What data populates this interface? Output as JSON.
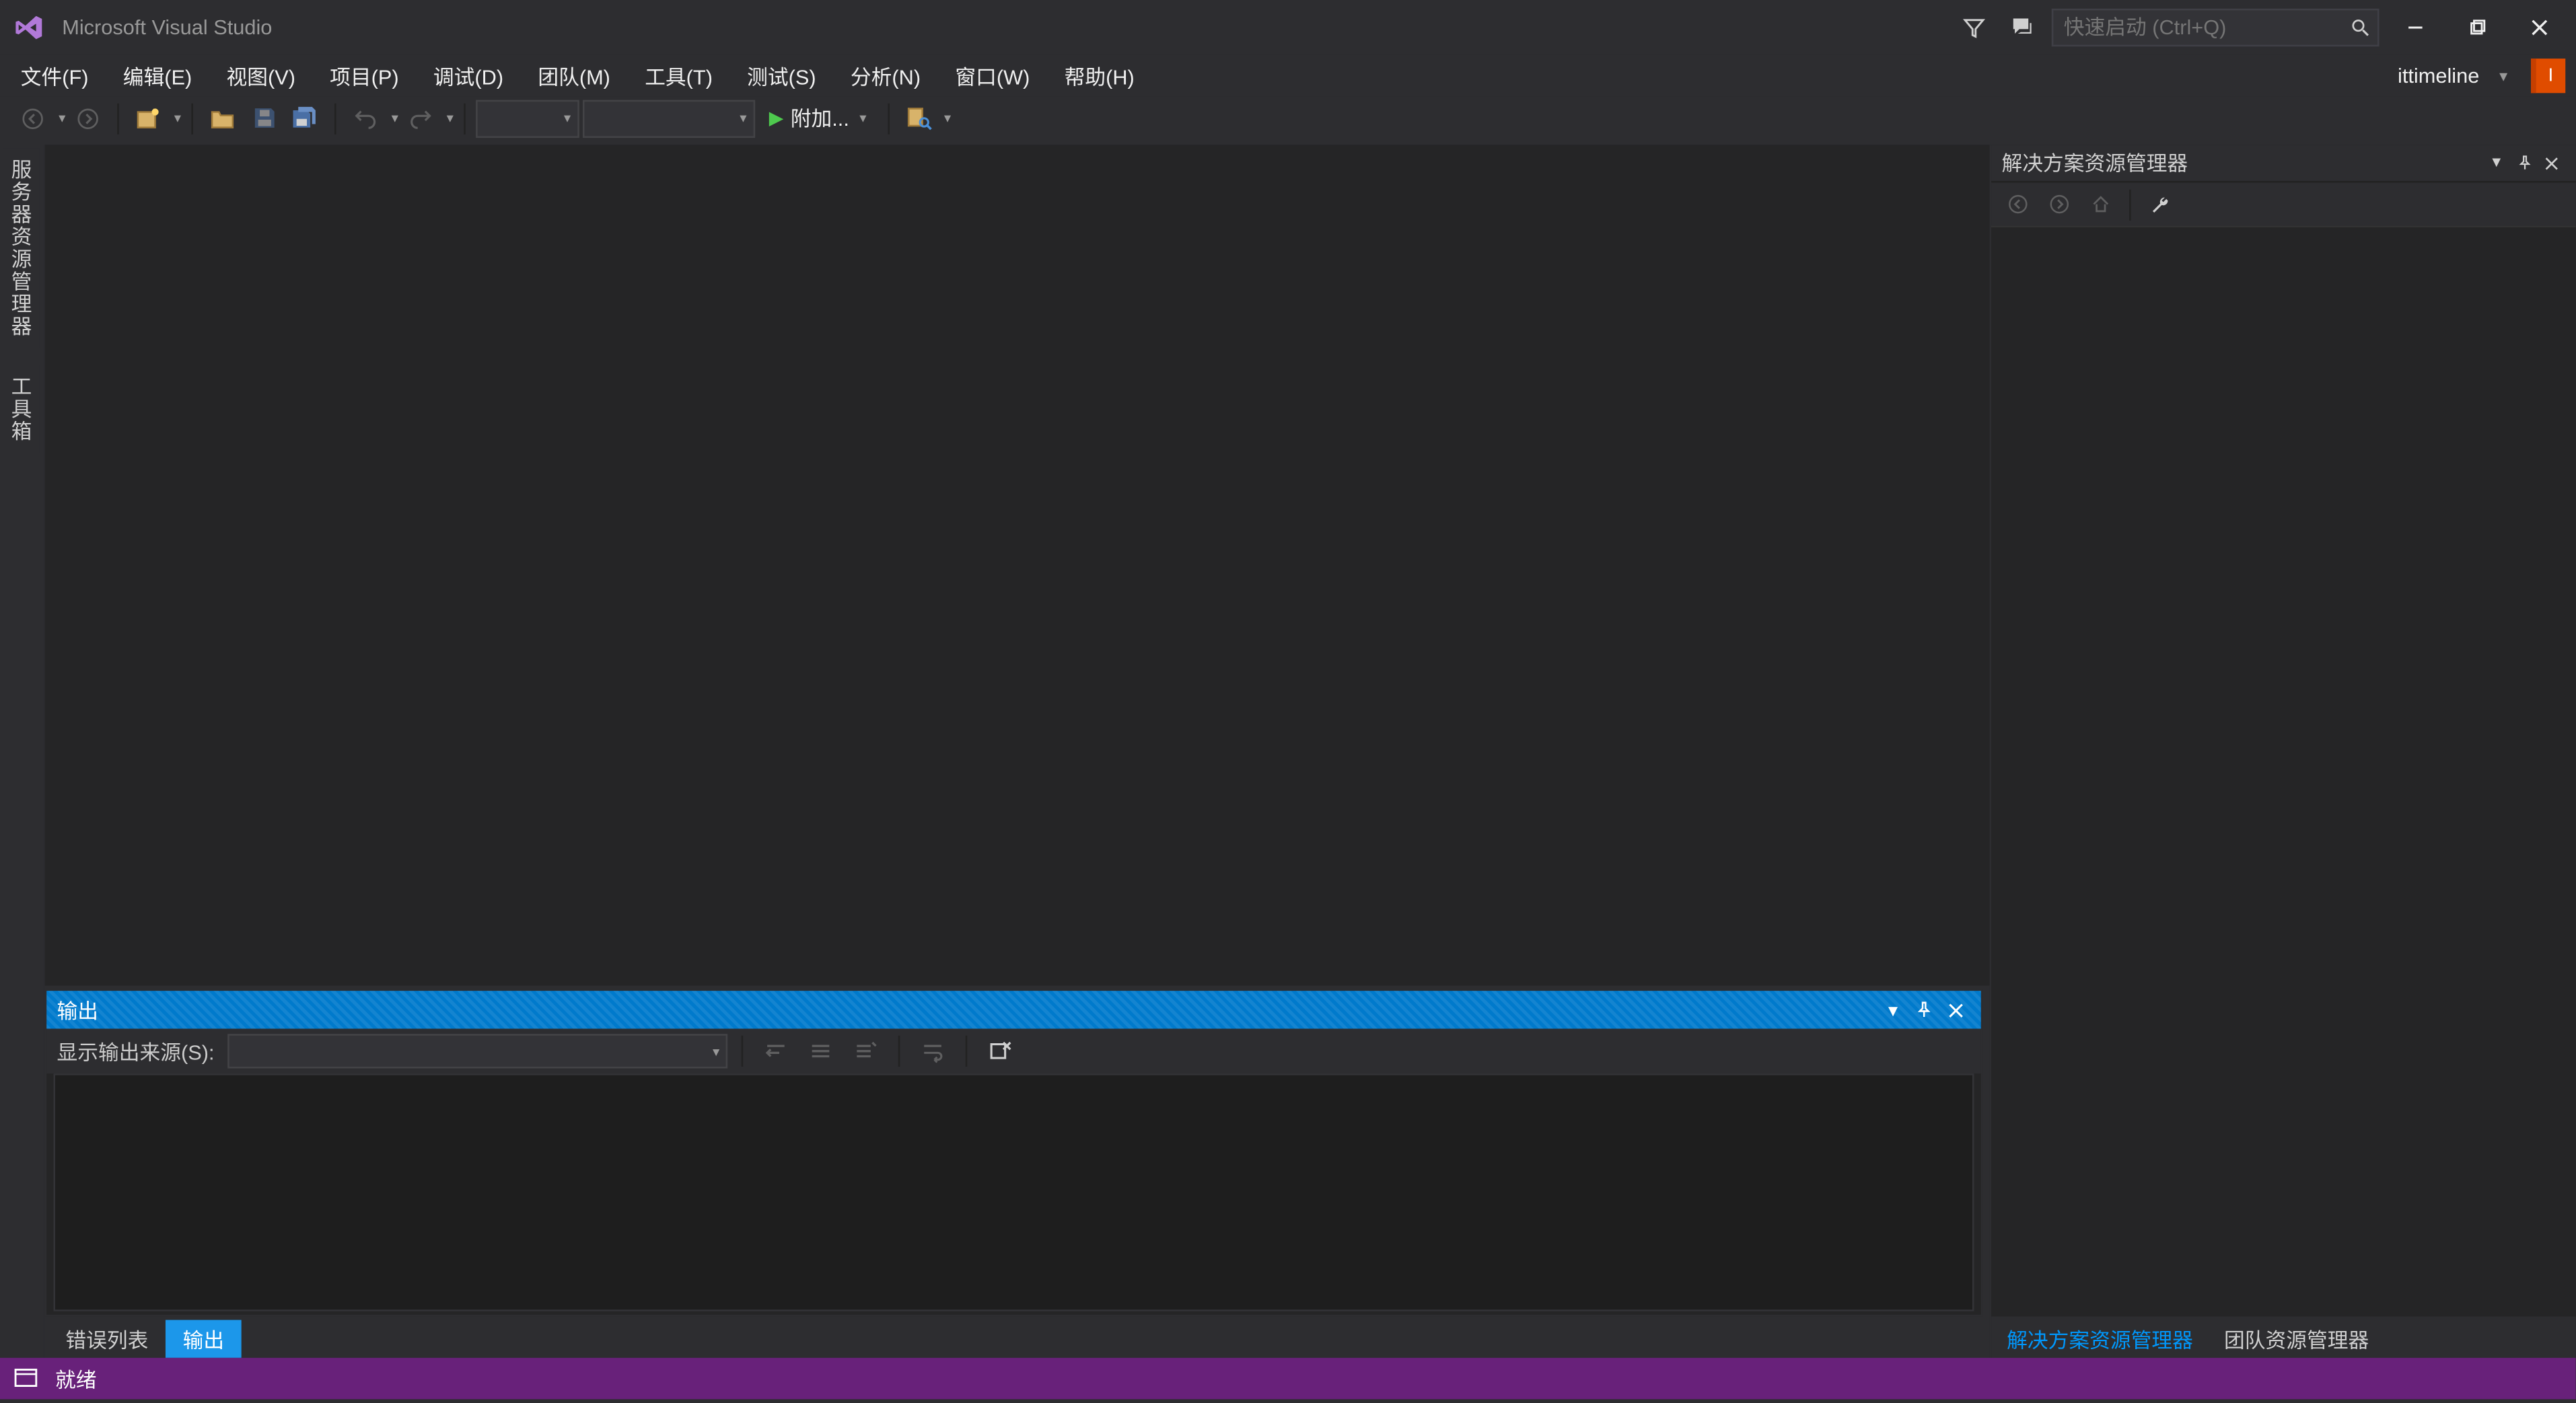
{
  "titlebar": {
    "app_title": "Microsoft Visual Studio",
    "quick_launch_placeholder": "快速启动 (Ctrl+Q)"
  },
  "menubar": {
    "items": [
      "文件(F)",
      "编辑(E)",
      "视图(V)",
      "项目(P)",
      "调试(D)",
      "团队(M)",
      "工具(T)",
      "测试(S)",
      "分析(N)",
      "窗口(W)",
      "帮助(H)"
    ],
    "account_name": "ittimeline",
    "account_initial": "I"
  },
  "toolbar": {
    "attach_label": "附加..."
  },
  "left_tabs": {
    "server_explorer": "服务器资源管理器",
    "toolbox": "工具箱"
  },
  "output_panel": {
    "title": "输出",
    "show_source_label": "显示输出来源(S):"
  },
  "bottom_tabs": {
    "error_list": "错误列表",
    "output": "输出"
  },
  "solution_explorer": {
    "title": "解决方案资源管理器"
  },
  "right_tabs": {
    "solution_explorer": "解决方案资源管理器",
    "team_explorer": "团队资源管理器"
  },
  "statusbar": {
    "ready": "就绪"
  }
}
